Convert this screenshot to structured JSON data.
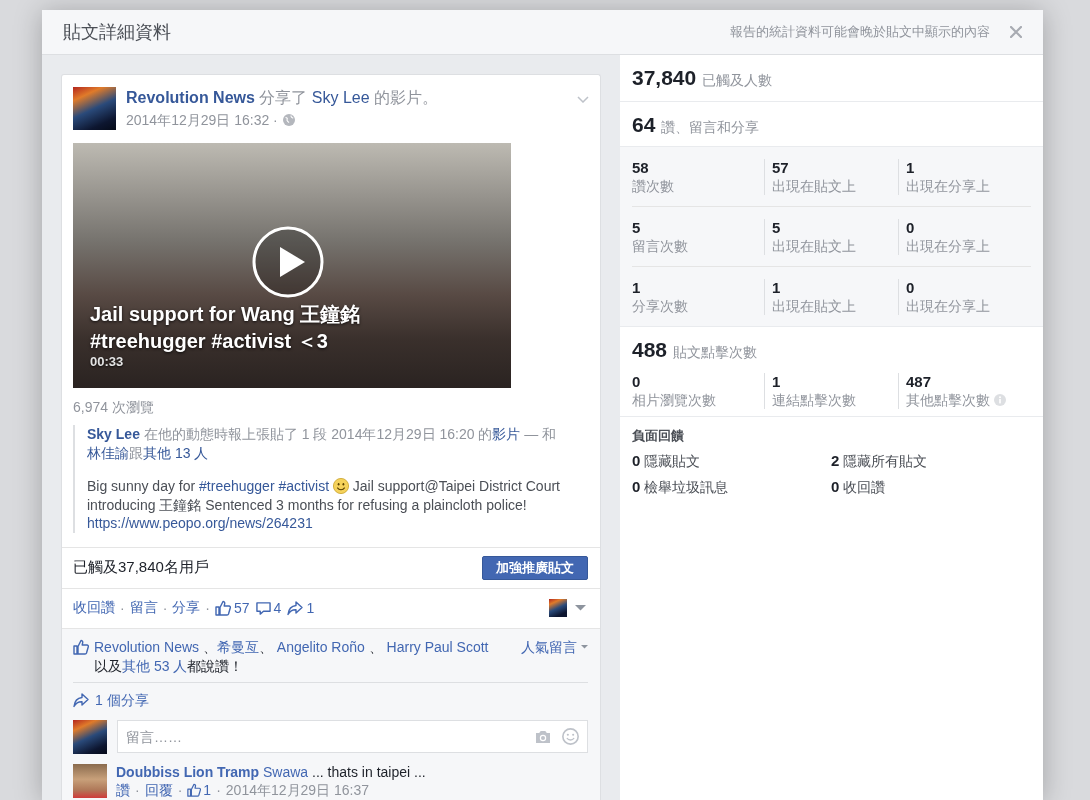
{
  "dialog": {
    "title": "貼文詳細資料",
    "note": "報告的統計資料可能會晚於貼文中顯示的內容"
  },
  "post": {
    "headline": [
      {
        "kind": "name",
        "text": "Revolution News"
      },
      {
        "kind": "text",
        "text": " 分享了 "
      },
      {
        "kind": "link",
        "text": "Sky Lee"
      },
      {
        "kind": "text",
        "text": " 的影片。"
      }
    ],
    "timestamp": "2014年12月29日 16:32 ·",
    "video": {
      "title": "Jail support for Wang 王鐘銘 #treehugger #activist ＜3",
      "duration": "00:33"
    },
    "views": "6,974 次瀏覽",
    "shared": {
      "header": [
        {
          "kind": "name",
          "text": "Sky Lee"
        },
        {
          "kind": "text",
          "text": " 在他的動態時報上張貼了 1 段 2014年12月29日 16:20 的"
        },
        {
          "kind": "link",
          "text": "影片"
        },
        {
          "kind": "text",
          "text": " — 和"
        },
        {
          "kind": "link",
          "text": "林佳諭"
        },
        {
          "kind": "text",
          "text": "跟"
        },
        {
          "kind": "link",
          "text": "其他 13 人"
        }
      ],
      "body": [
        {
          "kind": "text",
          "text": "Big sunny day for "
        },
        {
          "kind": "link",
          "text": "#treehugger"
        },
        {
          "kind": "space"
        },
        {
          "kind": "link",
          "text": "#activist"
        },
        {
          "kind": "space"
        },
        {
          "kind": "emoji"
        },
        {
          "kind": "text",
          "text": " Jail support@Taipei District Court introducing 王鐘銘 Sentenced 3 months for refusing a plaincloth police! "
        },
        {
          "kind": "link",
          "text": "https://www.peopo.org/news/264231"
        }
      ]
    },
    "reach": "已觸及37,840名用戶",
    "boost_button": "加強推廣貼文",
    "separator": "·",
    "actions": [
      "收回讚",
      "留言",
      "分享"
    ],
    "counts": [
      {
        "kind": "like",
        "value": "57"
      },
      {
        "kind": "comment",
        "value": "4"
      },
      {
        "kind": "share",
        "value": "1"
      }
    ],
    "likes": {
      "sentence": [
        {
          "kind": "link",
          "text": "Revolution News"
        },
        {
          "kind": "text",
          "text": " 、"
        },
        {
          "kind": "link",
          "text": "希曼亙"
        },
        {
          "kind": "text",
          "text": "、 "
        },
        {
          "kind": "link",
          "text": "Angelito Roño"
        },
        {
          "kind": "text",
          "text": " 、 "
        },
        {
          "kind": "link",
          "text": "Harry Paul Scott"
        },
        {
          "kind": "text",
          "text": " 以及"
        },
        {
          "kind": "link",
          "text": "其他 53 人"
        },
        {
          "kind": "text",
          "text": "都說讚！"
        }
      ],
      "sort": "人氣留言"
    },
    "shares": "1 個分享",
    "comment_box": {
      "placeholder": "留言……"
    },
    "comments": [
      {
        "author": "Doubbiss Lion Tramp",
        "text": [
          {
            "kind": "link",
            "text": "Swawa"
          },
          {
            "kind": "text",
            "text": " ... thats in taipei ..."
          }
        ],
        "actions": [
          "讚",
          "回覆"
        ],
        "likes": "1",
        "time": "2014年12月29日 16:37"
      }
    ]
  },
  "stats": {
    "reach": {
      "value": "37,840",
      "label": "已觸及人數"
    },
    "engagement": {
      "value": "64",
      "label": "讚、留言和分享"
    },
    "breakdown": [
      {
        "cells": [
          {
            "value": "58",
            "label": "讚次數"
          },
          {
            "value": "57",
            "label": "出現在貼文上"
          },
          {
            "value": "1",
            "label": "出現在分享上"
          }
        ]
      },
      {
        "cells": [
          {
            "value": "5",
            "label": "留言次數"
          },
          {
            "value": "5",
            "label": "出現在貼文上"
          },
          {
            "value": "0",
            "label": "出現在分享上"
          }
        ]
      },
      {
        "cells": [
          {
            "value": "1",
            "label": "分享次數"
          },
          {
            "value": "1",
            "label": "出現在貼文上"
          },
          {
            "value": "0",
            "label": "出現在分享上"
          }
        ]
      }
    ],
    "clicks": {
      "value": "488",
      "label": "貼文點擊次數",
      "items": [
        {
          "value": "0",
          "label": "相片瀏覽次數",
          "info": false
        },
        {
          "value": "1",
          "label": "連結點擊次數",
          "info": false
        },
        {
          "value": "487",
          "label": "其他點擊次數",
          "info": true
        }
      ]
    },
    "negative_feedback": {
      "title": "負面回饋",
      "items": [
        {
          "value": "0",
          "label": "隱藏貼文"
        },
        {
          "value": "2",
          "label": "隱藏所有貼文"
        },
        {
          "value": "0",
          "label": "檢舉垃圾訊息"
        },
        {
          "value": "0",
          "label": "收回讚"
        }
      ]
    }
  }
}
